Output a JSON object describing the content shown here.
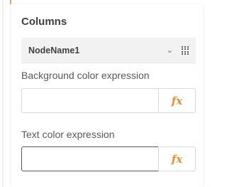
{
  "section": {
    "title": "Columns"
  },
  "column_item": {
    "label": "NodeName1",
    "chevron_icon": "chevron-down-icon",
    "handle_icon": "drag-handle-icon"
  },
  "background_color": {
    "label": "Background color expression",
    "value": "",
    "button_label": "fx"
  },
  "text_color": {
    "label": "Text color expression",
    "value": "",
    "button_label": "fx"
  },
  "colors": {
    "accent": "#f08c2b",
    "text": "#595959",
    "title": "#404040"
  }
}
